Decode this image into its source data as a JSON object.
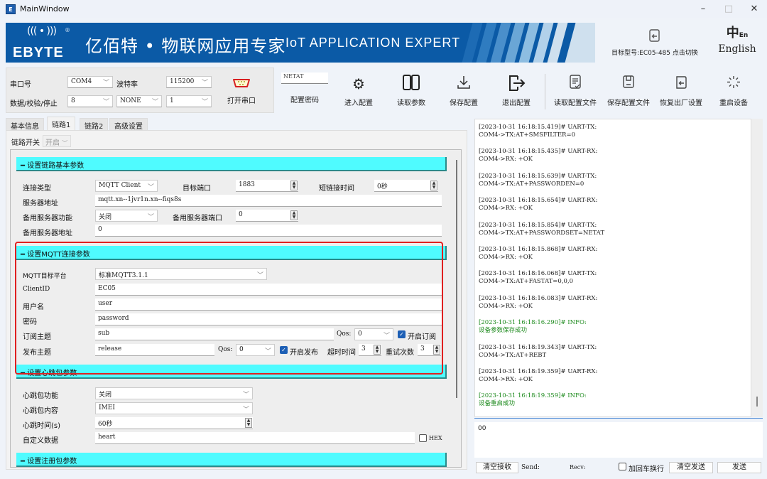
{
  "window": {
    "title": "MainWindow",
    "app_icon": "E",
    "minimize": "–",
    "maximize": "□",
    "close": "✕"
  },
  "banner": {
    "logo_waves": "((( • )))",
    "logo_reg": "®",
    "logo_text": "EBYTE",
    "title_cn": "亿佰特 • 物联网应用专家",
    "title_en": "IoT APPLICATION EXPERT",
    "stripe_colors": [
      "#1d6bb4",
      "#2f7cc0",
      "#4a8fcb",
      "#6aa6d6",
      "#8dbde1",
      "#b2d1ea",
      "#cfe0ee"
    ]
  },
  "header": {
    "target_model_label": "目标型号:EC05-485 点击切换",
    "language_label": "English"
  },
  "serial": {
    "port_label": "串口号",
    "port_value": "COM4",
    "baud_label": "波特率",
    "baud_value": "115200",
    "dps_label": "数据/校验/停止",
    "data_bits": "8",
    "parity": "NONE",
    "stop_bits": "1",
    "open_port_label": "打开串口"
  },
  "toolbar": {
    "password_value": "NETAT",
    "password_label": "配置密码",
    "buttons": [
      {
        "label": "进入配置",
        "icon": "⚙"
      },
      {
        "label": "读取参数",
        "icon": "▯▯"
      },
      {
        "label": "保存配置",
        "icon": "⤓"
      },
      {
        "label": "退出配置",
        "icon": "⇥"
      },
      {
        "label": "读取配置文件",
        "icon": "▤"
      },
      {
        "label": "保存配置文件",
        "icon": "▣"
      },
      {
        "label": "恢复出厂设置",
        "icon": "↩"
      },
      {
        "label": "重启设备",
        "icon": "✳"
      }
    ]
  },
  "tabs": [
    {
      "label": "基本信息",
      "active": false
    },
    {
      "label": "链路1",
      "active": true
    },
    {
      "label": "链路2",
      "active": false
    },
    {
      "label": "高级设置",
      "active": false
    }
  ],
  "link": {
    "switch_label": "链路开关",
    "switch_value": "开启"
  },
  "basic_section": {
    "header": "━ 设置链路基本参数",
    "conn_type_label": "连接类型",
    "conn_type_value": "MQTT Client",
    "target_port_label": "目标端口",
    "target_port_value": "1883",
    "short_conn_label": "短链接时间",
    "short_conn_value": "0秒",
    "server_addr_label": "服务器地址",
    "server_addr_value": "mqtt.xn--1jvr1n.xn--fiqs8s",
    "backup_func_label": "备用服务器功能",
    "backup_func_value": "关闭",
    "backup_port_label": "备用服务器端口",
    "backup_port_value": "0",
    "backup_addr_label": "备用服务器地址",
    "backup_addr_value": "0"
  },
  "mqtt_section": {
    "header": "━ 设置MQTT连接参数",
    "platform_label": "MQTT目标平台",
    "platform_value": "标准MQTT3.1.1",
    "clientid_label": "ClientID",
    "clientid_value": "EC05",
    "username_label": "用户名",
    "username_value": "user",
    "password_label": "密码",
    "password_value": "password",
    "sub_topic_label": "订阅主题",
    "sub_topic_value": "sub",
    "sub_qos_label": "Qos:",
    "sub_qos_value": "0",
    "sub_enable_label": "开启订阅",
    "sub_enable_checked": true,
    "pub_topic_label": "发布主题",
    "pub_topic_value": "release",
    "pub_qos_label": "Qos:",
    "pub_qos_value": "0",
    "pub_enable_label": "开启发布",
    "pub_enable_checked": true,
    "timeout_label": "超时时间",
    "timeout_value": "3",
    "retry_label": "重试次数",
    "retry_value": "3"
  },
  "heartbeat_section": {
    "header": "━ 设置心跳包参数",
    "func_label": "心跳包功能",
    "func_value": "关闭",
    "content_label": "心跳包内容",
    "content_value": "IMEI",
    "time_label": "心跳时间(s)",
    "time_value": "60秒",
    "custom_label": "自定义数据",
    "custom_value": "heart",
    "hex_label": "HEX",
    "hex_checked": false
  },
  "register_section": {
    "header": "━ 设置注册包参数"
  },
  "log": {
    "entries": [
      {
        "head": "[2023-10-31 16:18:15.419]# UART-TX:",
        "body": "COM4->TX:AT+SMSFILTER=0",
        "type": "normal"
      },
      {
        "head": "[2023-10-31 16:18:15.435]# UART-RX:",
        "body": "COM4->RX: +OK",
        "type": "normal"
      },
      {
        "head": "[2023-10-31 16:18:15.639]# UART-TX:",
        "body": "COM4->TX:AT+PASSWORDEN=0",
        "type": "normal"
      },
      {
        "head": "[2023-10-31 16:18:15.654]# UART-RX:",
        "body": "COM4->RX: +OK",
        "type": "normal"
      },
      {
        "head": "[2023-10-31 16:18:15.854]# UART-TX:",
        "body": "COM4->TX:AT+PASSWORDSET=NETAT",
        "type": "normal"
      },
      {
        "head": "[2023-10-31 16:18:15.868]# UART-RX:",
        "body": "COM4->RX: +OK",
        "type": "normal"
      },
      {
        "head": "[2023-10-31 16:18:16.068]# UART-TX:",
        "body": "COM4->TX:AT+FASTAT=0,0,0",
        "type": "normal"
      },
      {
        "head": "[2023-10-31 16:18:16.083]# UART-RX:",
        "body": "COM4->RX: +OK",
        "type": "normal"
      },
      {
        "head": "[2023-10-31 16:18:16.290]# INFO:",
        "body": "设备参数保存成功",
        "type": "info"
      },
      {
        "head": "[2023-10-31 16:18:19.343]# UART-TX:",
        "body": "COM4->TX:AT+REBT",
        "type": "normal"
      },
      {
        "head": "[2023-10-31 16:18:19.359]# UART-RX:",
        "body": "COM4->RX: +OK",
        "type": "normal"
      },
      {
        "head": "[2023-10-31 16:18:19.359]# INFO:",
        "body": "设备重启成功",
        "type": "info"
      }
    ]
  },
  "send": {
    "input_value": "00",
    "clear_recv_label": "清空接收",
    "send_count_label": "Send:",
    "recv_count_label": "Recv:",
    "crlf_label": "加回车换行",
    "crlf_checked": false,
    "clear_send_label": "清空发送",
    "send_label": "发送"
  }
}
